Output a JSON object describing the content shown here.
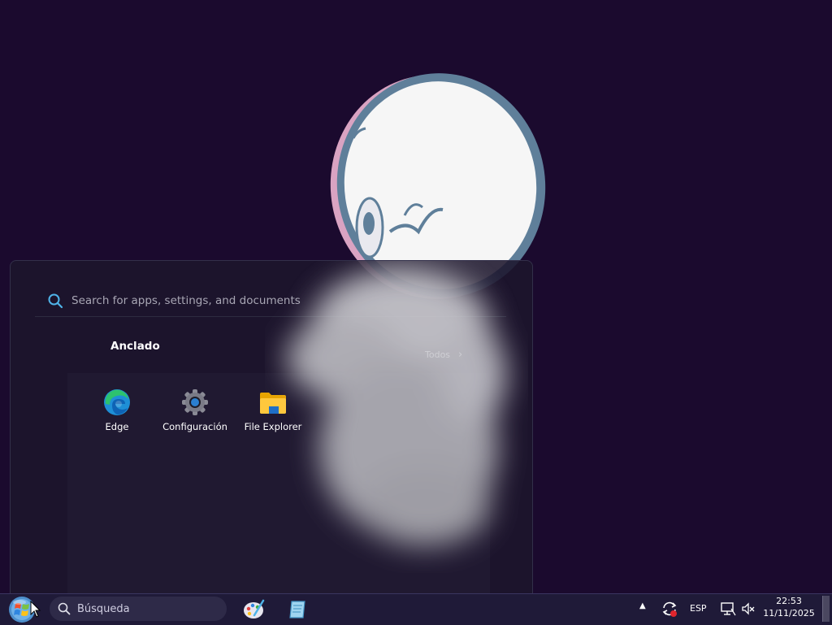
{
  "start_menu": {
    "search_placeholder": "Search for apps, settings, and documents",
    "pinned_title": "Anclado",
    "all_button_label": "Todos",
    "pinned_apps": [
      {
        "label": "Edge",
        "icon": "edge-icon"
      },
      {
        "label": "Configuración",
        "icon": "gear-icon"
      },
      {
        "label": "File Explorer",
        "icon": "folder-icon"
      }
    ]
  },
  "taskbar": {
    "search_text": "Búsqueda",
    "apps": [
      {
        "icon": "paint-palette-icon"
      },
      {
        "icon": "notepad-icon"
      }
    ],
    "tray": {
      "language": "ESP",
      "time": "22:53",
      "date": "11/11/2025"
    }
  },
  "colors": {
    "desktop_background": "#1b0a2e",
    "start_menu_background": "#1c162c",
    "taskbar_background": "#1f1a38",
    "search_accent": "#4fb3e8"
  }
}
